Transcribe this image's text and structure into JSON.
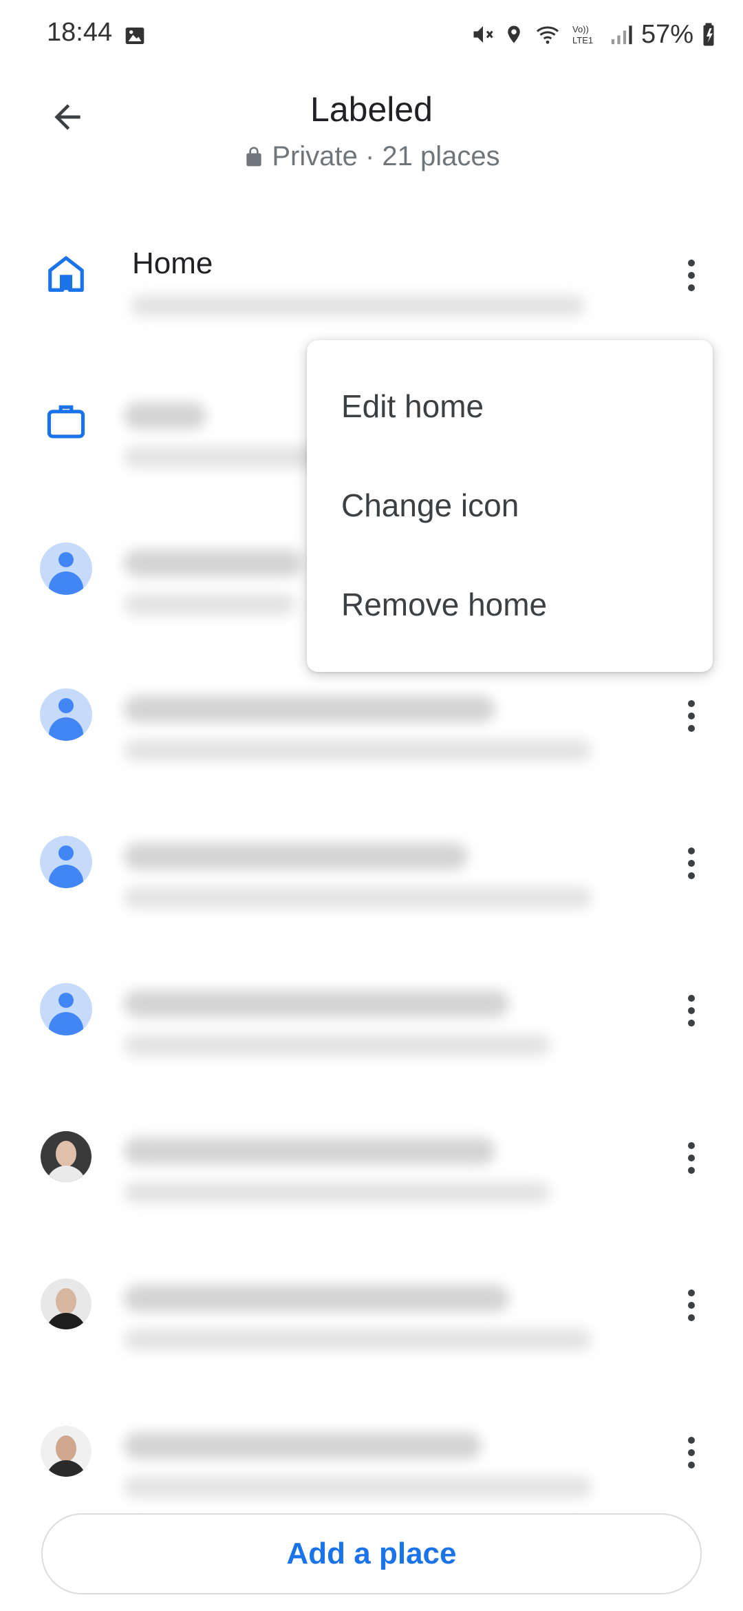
{
  "status_bar": {
    "time": "18:44",
    "battery": "57%",
    "network_label": "Vo)) LTE1",
    "icons": [
      "image-icon",
      "mute-icon",
      "location-icon",
      "wifi-icon",
      "volte-icon",
      "signal-icon",
      "battery-icon"
    ]
  },
  "header": {
    "title": "Labeled",
    "subtitle": "Private · 21 places",
    "back_icon": "arrow-back-icon",
    "lock_icon": "lock-icon"
  },
  "list": {
    "home": {
      "title": "Home",
      "icon": "home-icon"
    },
    "work": {
      "icon": "work-briefcase-icon"
    }
  },
  "menu": {
    "items": [
      "Edit home",
      "Change icon",
      "Remove home"
    ]
  },
  "footer": {
    "add_place": "Add a place"
  },
  "colors": {
    "accent": "#1a73e8",
    "icon_blue": "#1a73e8",
    "avatar_bg": "#c6dafc",
    "avatar_fg": "#4285f4",
    "text_secondary": "#70757a"
  }
}
